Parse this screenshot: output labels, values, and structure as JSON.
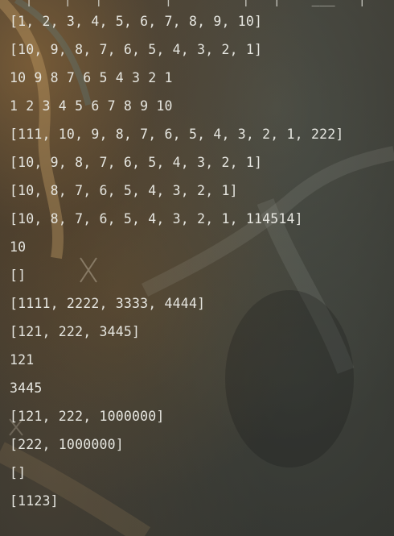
{
  "terminal": {
    "top_partial": "  |    |   |        |         |   |    ___   |    ,",
    "lines": [
      "[1, 2, 3, 4, 5, 6, 7, 8, 9, 10]",
      "[10, 9, 8, 7, 6, 5, 4, 3, 2, 1]",
      "10 9 8 7 6 5 4 3 2 1",
      "1 2 3 4 5 6 7 8 9 10",
      "[111, 10, 9, 8, 7, 6, 5, 4, 3, 2, 1, 222]",
      "[10, 9, 8, 7, 6, 5, 4, 3, 2, 1]",
      "[10, 8, 7, 6, 5, 4, 3, 2, 1]",
      "[10, 8, 7, 6, 5, 4, 3, 2, 1, 114514]",
      "10",
      "[]",
      "[1111, 2222, 3333, 4444]",
      "[121, 222, 3445]",
      "121",
      "3445",
      "[121, 222, 1000000]",
      "[222, 1000000]",
      "[]",
      "[1123]"
    ]
  },
  "colors": {
    "text": "#e6e6e0",
    "background": "#34342f"
  }
}
